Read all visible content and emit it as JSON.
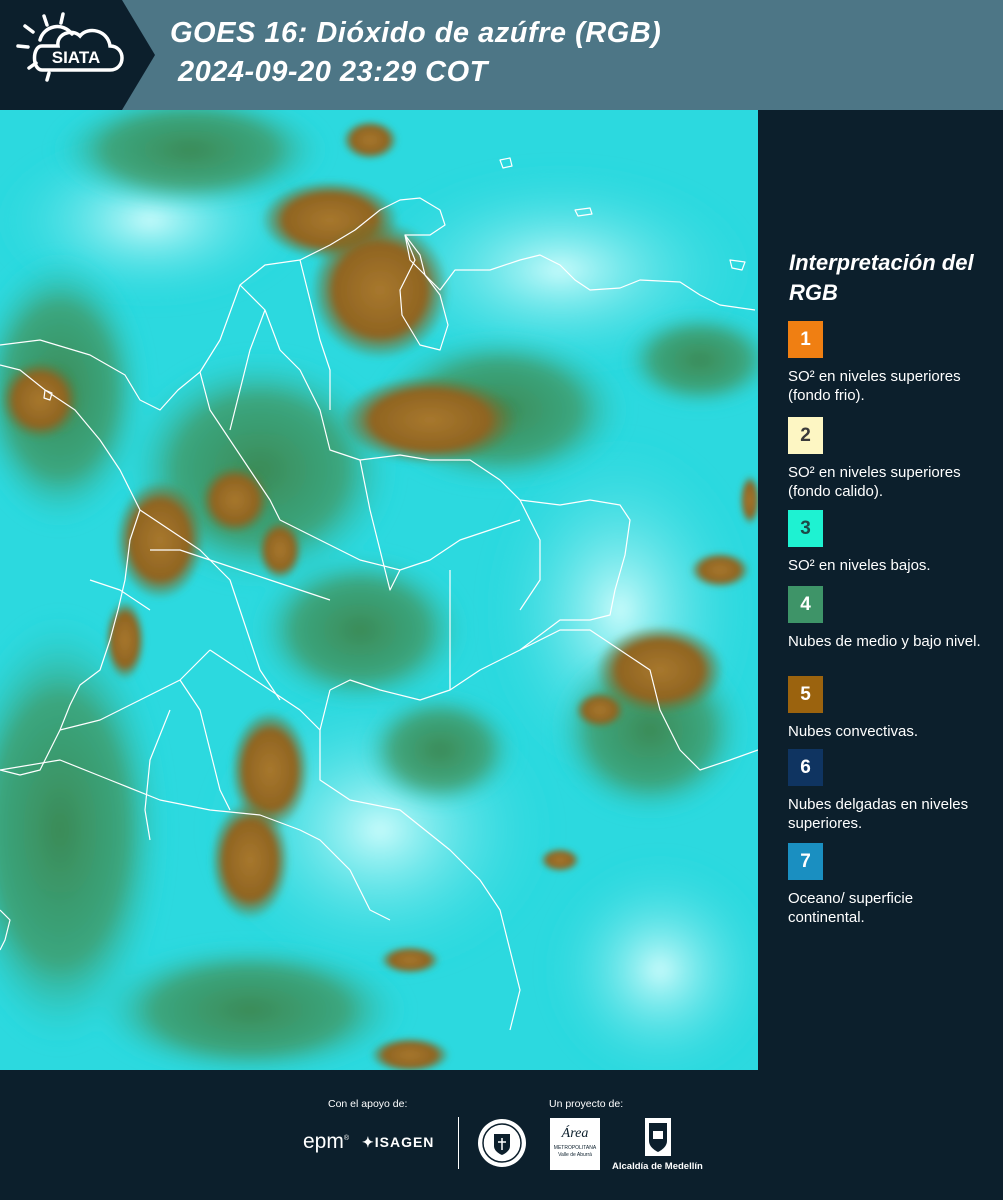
{
  "header": {
    "logo_text": "SIATA",
    "title_line1": "GOES 16: Dióxido de azúfre (RGB)",
    "title_line2": "2024-09-20 23:29 COT"
  },
  "legend": {
    "title": "Interpretación del RGB",
    "items": [
      {
        "number": "1",
        "color": "#f07f12",
        "number_color": "#ffffff",
        "label": "SO² en niveles superiores (fondo frio)."
      },
      {
        "number": "2",
        "color": "#fdf6c3",
        "number_color": "#3a3a3a",
        "label": "SO² en niveles superiores (fondo calido)."
      },
      {
        "number": "3",
        "color": "#1ef2d2",
        "number_color": "#1d4a48",
        "label": "SO² en niveles bajos."
      },
      {
        "number": "4",
        "color": "#3e9468",
        "number_color": "#ffffff",
        "label": "Nubes de medio y bajo nivel."
      },
      {
        "number": "5",
        "color": "#9b630e",
        "number_color": "#ffffff",
        "label": "Nubes convectivas."
      },
      {
        "number": "6",
        "color": "#0f3461",
        "number_color": "#ffffff",
        "label": "Nubes delgadas en niveles superiores."
      },
      {
        "number": "7",
        "color": "#1a8fc1",
        "number_color": "#ffffff",
        "label": "Oceano/ superficie continental."
      }
    ]
  },
  "footer": {
    "support_label": "Con el apoyo de:",
    "project_label": "Un proyecto de:",
    "sponsors": [
      "epm",
      "ISAGEN"
    ],
    "partners": [
      "Área",
      "METROPOLITANA",
      "Valle de Aburrá",
      "Alcaldía de Medellín"
    ]
  },
  "colors": {
    "header_bg": "#4d7686",
    "page_bg": "#0c1f2c",
    "map_cyan": "#2ce0e6",
    "cloud_brown": "#9b6c25",
    "cloud_green": "#3f8c5c"
  }
}
